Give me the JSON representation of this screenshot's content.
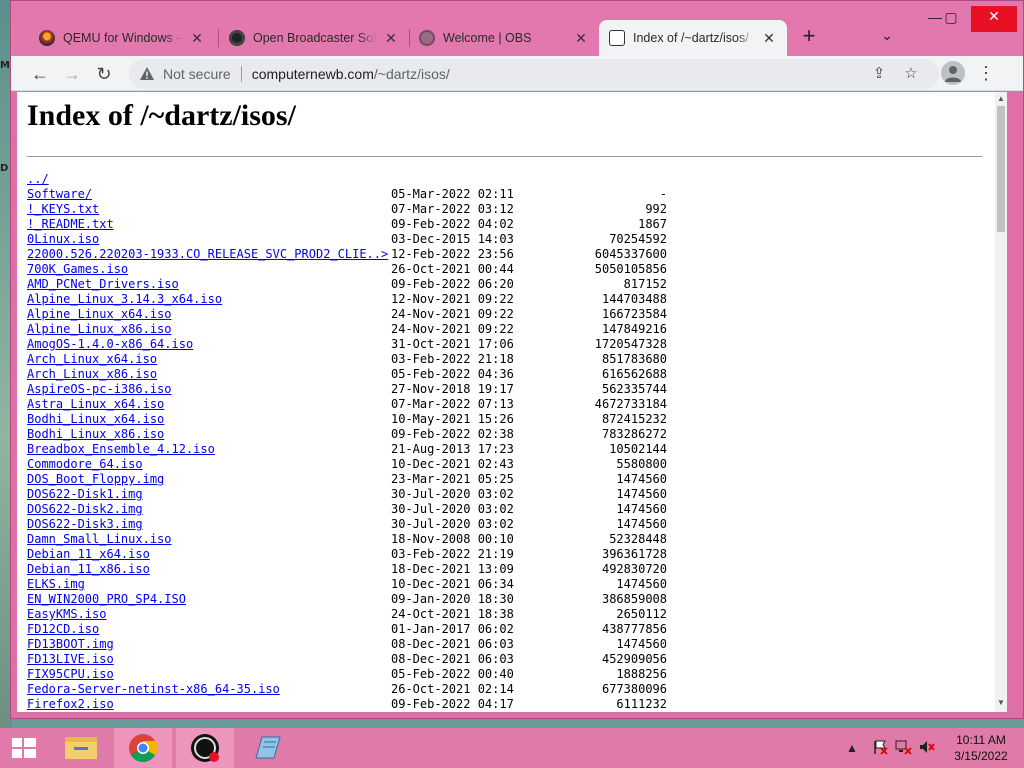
{
  "desktop": {
    "left_labels": [
      "M",
      "D"
    ]
  },
  "tabs": [
    {
      "title": "QEMU for Windows – In",
      "icon": "qemu-icon",
      "active": false
    },
    {
      "title": "Open Broadcaster Softw",
      "icon": "obs-icon",
      "active": false
    },
    {
      "title": "Welcome | OBS",
      "icon": "globe-icon",
      "active": false
    },
    {
      "title": "Index of /~dartz/isos/",
      "icon": "page-icon",
      "active": true
    }
  ],
  "tab_close_glyph": "✕",
  "new_tab_glyph": "+",
  "window_controls": {
    "minimize": "—",
    "maximize": "▢",
    "close": "✕"
  },
  "address_bar": {
    "security_label": "Not secure",
    "host": "computernewb.com",
    "path": "/~dartz/isos/"
  },
  "page": {
    "heading": "Index of /~dartz/isos/",
    "entries": [
      {
        "name": "../",
        "date": "",
        "size": ""
      },
      {
        "name": "Software/",
        "date": "05-Mar-2022 02:11",
        "size": "-"
      },
      {
        "name": "!_KEYS.txt",
        "date": "07-Mar-2022 03:12",
        "size": "992"
      },
      {
        "name": "!_README.txt",
        "date": "09-Feb-2022 04:02",
        "size": "1867"
      },
      {
        "name": "0Linux.iso",
        "date": "03-Dec-2015 14:03",
        "size": "70254592"
      },
      {
        "name": "22000.526.220203-1933.CO_RELEASE_SVC_PROD2_CLIE..>",
        "date": "12-Feb-2022 23:56",
        "size": "6045337600"
      },
      {
        "name": "700K_Games.iso",
        "date": "26-Oct-2021 00:44",
        "size": "5050105856"
      },
      {
        "name": "AMD_PCNet_Drivers.iso",
        "date": "09-Feb-2022 06:20",
        "size": "817152"
      },
      {
        "name": "Alpine_Linux_3.14.3_x64.iso",
        "date": "12-Nov-2021 09:22",
        "size": "144703488"
      },
      {
        "name": "Alpine_Linux_x64.iso",
        "date": "24-Nov-2021 09:22",
        "size": "166723584"
      },
      {
        "name": "Alpine_Linux_x86.iso",
        "date": "24-Nov-2021 09:22",
        "size": "147849216"
      },
      {
        "name": "AmogOS-1.4.0-x86_64.iso",
        "date": "31-Oct-2021 17:06",
        "size": "1720547328"
      },
      {
        "name": "Arch_Linux_x64.iso",
        "date": "03-Feb-2022 21:18",
        "size": "851783680"
      },
      {
        "name": "Arch_Linux_x86.iso",
        "date": "05-Feb-2022 04:36",
        "size": "616562688"
      },
      {
        "name": "AspireOS-pc-i386.iso",
        "date": "27-Nov-2018 19:17",
        "size": "562335744"
      },
      {
        "name": "Astra_Linux_x64.iso",
        "date": "07-Mar-2022 07:13",
        "size": "4672733184"
      },
      {
        "name": "Bodhi_Linux_x64.iso",
        "date": "10-May-2021 15:26",
        "size": "872415232"
      },
      {
        "name": "Bodhi_Linux_x86.iso",
        "date": "09-Feb-2022 02:38",
        "size": "783286272"
      },
      {
        "name": "Breadbox_Ensemble_4.12.iso",
        "date": "21-Aug-2013 17:23",
        "size": "10502144"
      },
      {
        "name": "Commodore_64.iso",
        "date": "10-Dec-2021 02:43",
        "size": "5580800"
      },
      {
        "name": "DOS_Boot_Floppy.img",
        "date": "23-Mar-2021 05:25",
        "size": "1474560"
      },
      {
        "name": "DOS622-Disk1.img",
        "date": "30-Jul-2020 03:02",
        "size": "1474560"
      },
      {
        "name": "DOS622-Disk2.img",
        "date": "30-Jul-2020 03:02",
        "size": "1474560"
      },
      {
        "name": "DOS622-Disk3.img",
        "date": "30-Jul-2020 03:02",
        "size": "1474560"
      },
      {
        "name": "Damn_Small_Linux.iso",
        "date": "18-Nov-2008 00:10",
        "size": "52328448"
      },
      {
        "name": "Debian_11_x64.iso",
        "date": "03-Feb-2022 21:19",
        "size": "396361728"
      },
      {
        "name": "Debian_11_x86.iso",
        "date": "18-Dec-2021 13:09",
        "size": "492830720"
      },
      {
        "name": "ELKS.img",
        "date": "10-Dec-2021 06:34",
        "size": "1474560"
      },
      {
        "name": "EN_WIN2000_PRO_SP4.ISO",
        "date": "09-Jan-2020 18:30",
        "size": "386859008"
      },
      {
        "name": "EasyKMS.iso",
        "date": "24-Oct-2021 18:38",
        "size": "2650112"
      },
      {
        "name": "FD12CD.iso",
        "date": "01-Jan-2017 06:02",
        "size": "438777856"
      },
      {
        "name": "FD13BOOT.img",
        "date": "08-Dec-2021 06:03",
        "size": "1474560"
      },
      {
        "name": "FD13LIVE.iso",
        "date": "08-Dec-2021 06:03",
        "size": "452909056"
      },
      {
        "name": "FIX95CPU.iso",
        "date": "05-Feb-2022 00:40",
        "size": "1888256"
      },
      {
        "name": "Fedora-Server-netinst-x86_64-35.iso",
        "date": "26-Oct-2021 02:14",
        "size": "677380096"
      },
      {
        "name": "Firefox2.iso",
        "date": "09-Feb-2022 04:17",
        "size": "6111232"
      }
    ]
  },
  "taskbar": {
    "apps": [
      {
        "name": "file-explorer-icon",
        "open": false
      },
      {
        "name": "chrome-icon",
        "open": true
      },
      {
        "name": "obs-icon",
        "open": true
      },
      {
        "name": "notepad-icon",
        "open": false
      }
    ],
    "clock_time": "10:11 AM",
    "clock_date": "3/15/2022"
  },
  "colors": {
    "frame": "#e278ad",
    "link": "#0000ee",
    "taskbar": "#e07aa8"
  }
}
